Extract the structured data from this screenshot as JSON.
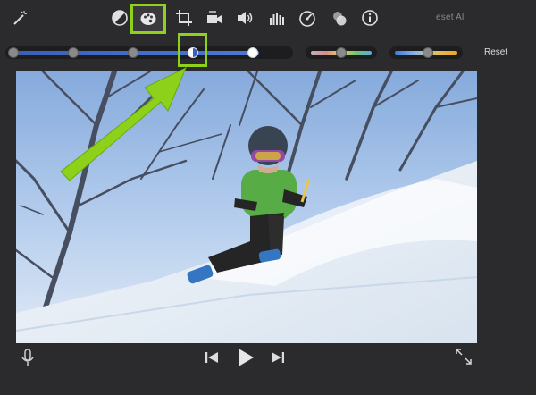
{
  "toolbar": {
    "reset_all_label": "eset All",
    "tools": [
      {
        "name": "magic-wand-icon"
      },
      {
        "name": "color-balance-icon"
      },
      {
        "name": "color-correction-icon"
      },
      {
        "name": "crop-icon"
      },
      {
        "name": "stabilization-icon"
      },
      {
        "name": "volume-icon"
      },
      {
        "name": "noise-reduction-icon"
      },
      {
        "name": "speed-icon"
      },
      {
        "name": "clip-filter-icon"
      },
      {
        "name": "info-icon"
      }
    ]
  },
  "adjust": {
    "reset_label": "Reset",
    "main_slider_position": 0.66,
    "saturation_position": 0.5,
    "temperature_position": 0.55
  },
  "colors": {
    "accent": "#8ed11a",
    "slider_blue": "#3a5fb8",
    "background": "#2b2b2d"
  }
}
